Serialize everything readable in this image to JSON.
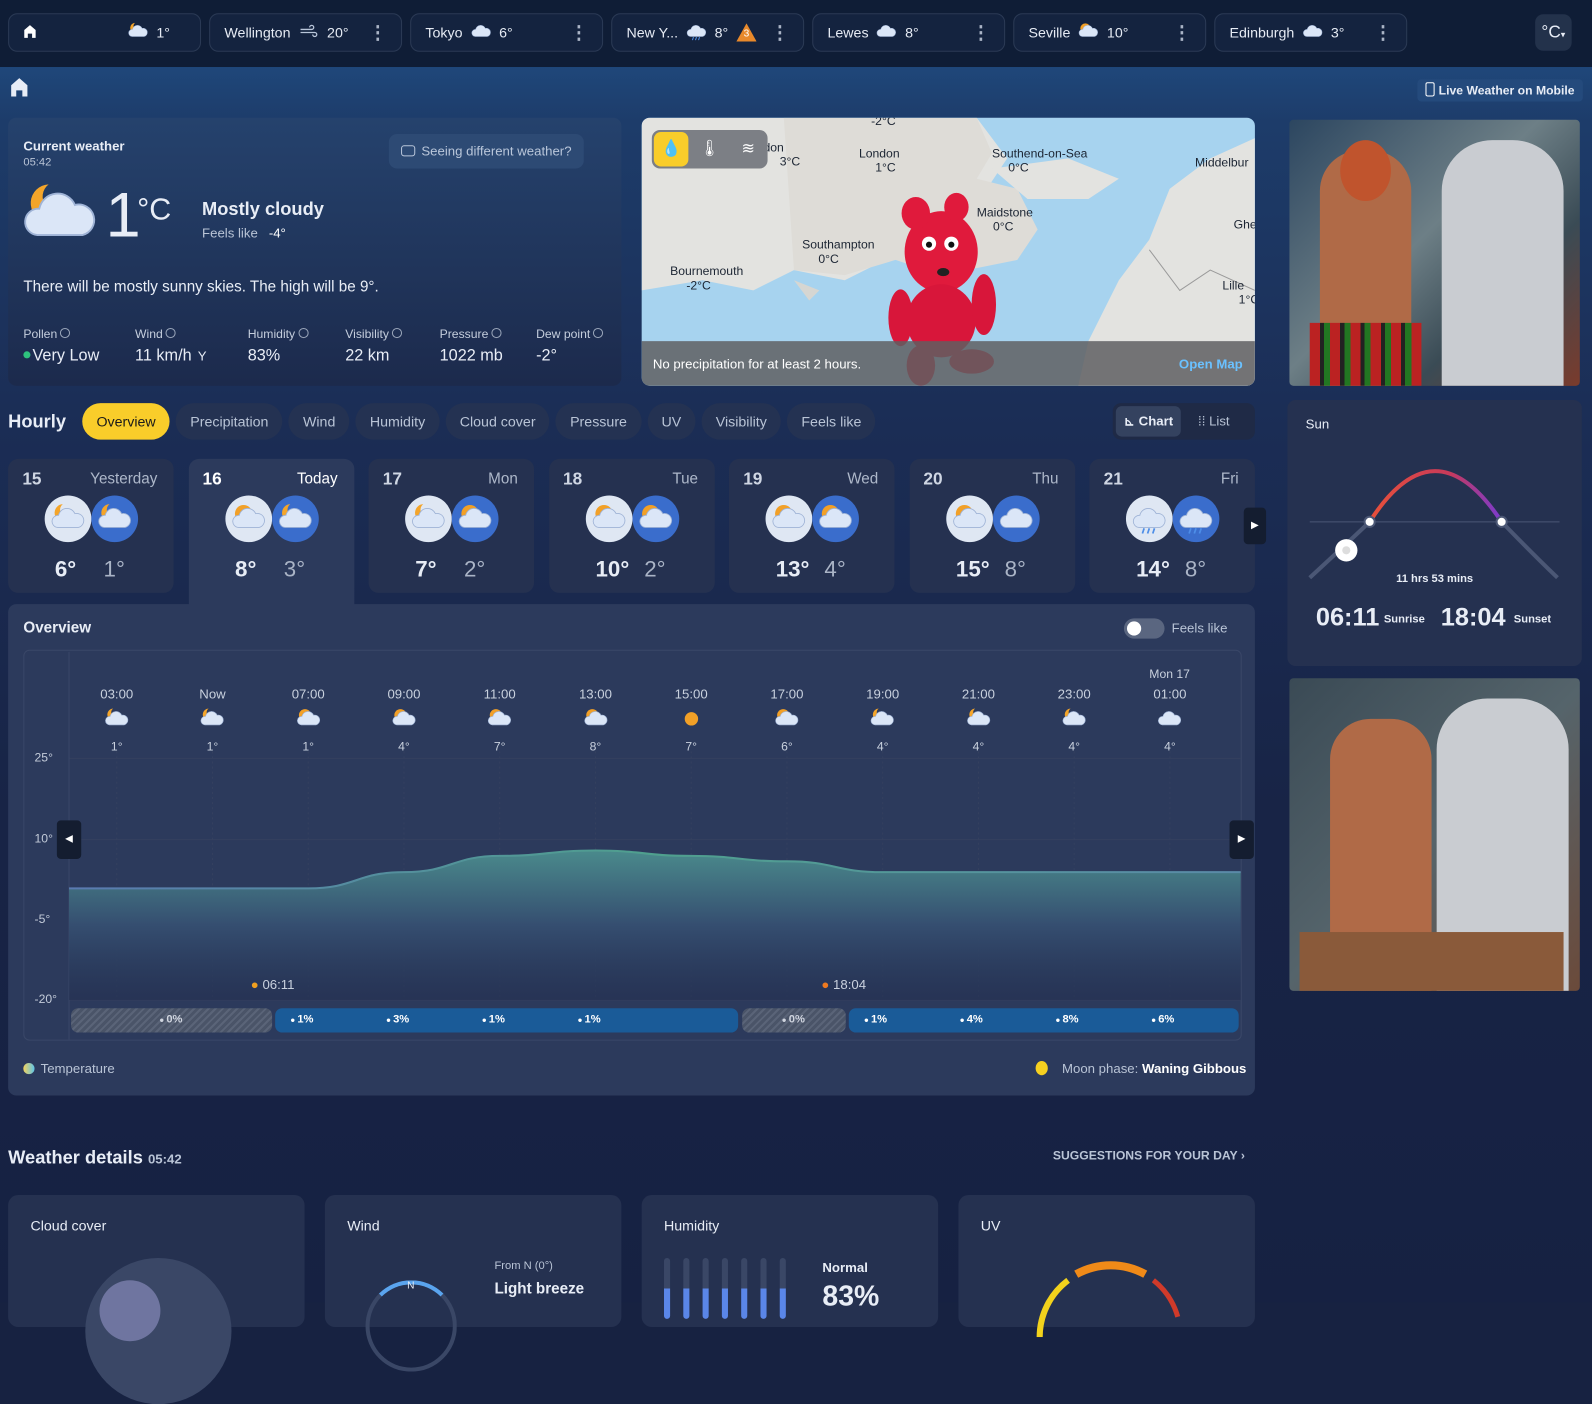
{
  "locations": [
    {
      "name": "",
      "temp": "1°",
      "icon": "moon-cloud",
      "home": true
    },
    {
      "name": "Wellington",
      "temp": "20°",
      "icon": "windy"
    },
    {
      "name": "Tokyo",
      "temp": "6°",
      "icon": "cloud"
    },
    {
      "name": "New Y...",
      "temp": "8°",
      "icon": "rain-cloud",
      "alert": "3"
    },
    {
      "name": "Lewes",
      "temp": "8°",
      "icon": "cloud"
    },
    {
      "name": "Seville",
      "temp": "10°",
      "icon": "sun-cloud"
    },
    {
      "name": "Edinburgh",
      "temp": "3°",
      "icon": "cloud"
    }
  ],
  "unit": "°C",
  "mobile_label": "Live Weather on Mobile",
  "current": {
    "title": "Current weather",
    "time": "05:42",
    "temp": "1",
    "unit": "°C",
    "condition": "Mostly cloudy",
    "feels_label": "Feels like",
    "feels_value": "-4°",
    "feedback": "Seeing different weather?",
    "summary": "There will be mostly sunny skies. The high will be 9°.",
    "stats": [
      {
        "label": "Pollen",
        "value": "Very Low"
      },
      {
        "label": "Wind",
        "value": "11 km/h"
      },
      {
        "label": "Humidity",
        "value": "83%"
      },
      {
        "label": "Visibility",
        "value": "22 km"
      },
      {
        "label": "Pressure",
        "value": "1022 mb"
      },
      {
        "label": "Dew point",
        "value": "-2°"
      }
    ]
  },
  "map": {
    "labels": [
      {
        "name": "London",
        "temp": "1°C"
      },
      {
        "name": "Southend-on-Sea",
        "temp": "0°C"
      },
      {
        "name": "Maidstone",
        "temp": "0°C"
      },
      {
        "name": "Southampton",
        "temp": "0°C"
      },
      {
        "name": "Bournemouth",
        "temp": "-2°C"
      },
      {
        "name": "Lille",
        "temp": "1°C"
      },
      {
        "name": "Middelbur",
        "temp": ""
      },
      {
        "name": "don",
        "temp": "3°C"
      },
      {
        "name": "",
        "temp": "-2°C"
      },
      {
        "name": "Ghe",
        "temp": ""
      }
    ],
    "status": "No precipitation for at least 2 hours.",
    "open": "Open Map"
  },
  "hourly": {
    "title": "Hourly",
    "tabs": [
      "Overview",
      "Precipitation",
      "Wind",
      "Humidity",
      "Cloud cover",
      "Pressure",
      "UV",
      "Visibility",
      "Feels like"
    ],
    "view_chart": "Chart",
    "view_list": "List"
  },
  "days": [
    {
      "num": "15",
      "name": "Yesterday",
      "hi": "6°",
      "lo": "1°"
    },
    {
      "num": "16",
      "name": "Today",
      "hi": "8°",
      "lo": "3°"
    },
    {
      "num": "17",
      "name": "Mon",
      "hi": "7°",
      "lo": "2°"
    },
    {
      "num": "18",
      "name": "Tue",
      "hi": "10°",
      "lo": "2°"
    },
    {
      "num": "19",
      "name": "Wed",
      "hi": "13°",
      "lo": "4°"
    },
    {
      "num": "20",
      "name": "Thu",
      "hi": "15°",
      "lo": "8°"
    },
    {
      "num": "21",
      "name": "Fri",
      "hi": "14°",
      "lo": "8°"
    }
  ],
  "overview": {
    "title": "Overview",
    "feels_toggle": "Feels like",
    "next_day_label": "Mon 17",
    "sunrise": "06:11",
    "sunset": "18:04",
    "legend": "Temperature",
    "moon_label": "Moon phase:",
    "moon_value": "Waning Gibbous"
  },
  "chart_data": {
    "type": "area",
    "ylabel_ticks": [
      "25°",
      "10°",
      "-5°",
      "-20°"
    ],
    "ylim": [
      -20,
      25
    ],
    "hours": [
      "03:00",
      "Now",
      "07:00",
      "09:00",
      "11:00",
      "13:00",
      "15:00",
      "17:00",
      "19:00",
      "21:00",
      "23:00",
      "01:00"
    ],
    "icons": [
      "moon-cloud",
      "moon-cloud",
      "sun-cloud",
      "sun-cloud",
      "sun-cloud",
      "sun-cloud",
      "sun",
      "sun-cloud",
      "moon-cloud",
      "moon-cloud",
      "moon-cloud",
      "cloud"
    ],
    "temps": [
      1,
      1,
      1,
      4,
      7,
      8,
      7,
      6,
      4,
      4,
      4,
      4
    ],
    "temps_display": [
      "1°",
      "1°",
      "1°",
      "4°",
      "7°",
      "8°",
      "7°",
      "6°",
      "4°",
      "4°",
      "4°",
      "4°"
    ],
    "precip": [
      {
        "type": "dry",
        "values": [
          "0%"
        ]
      },
      {
        "type": "wet",
        "values": [
          "1%",
          "3%",
          "1%",
          "1%"
        ]
      },
      {
        "type": "dry",
        "values": [
          "0%"
        ]
      },
      {
        "type": "wet",
        "values": [
          "1%",
          "4%",
          "8%",
          "6%"
        ]
      }
    ]
  },
  "sun": {
    "title": "Sun",
    "duration": "11 hrs 53 mins",
    "sunrise": "06:11",
    "sunrise_label": "Sunrise",
    "sunset": "18:04",
    "sunset_label": "Sunset"
  },
  "details": {
    "title": "Weather details",
    "time": "05:42",
    "suggestions": "SUGGESTIONS FOR YOUR DAY",
    "cards": [
      {
        "title": "Cloud cover"
      },
      {
        "title": "Wind",
        "from": "From N (0°)",
        "desc": "Light breeze",
        "compass": "N"
      },
      {
        "title": "Humidity",
        "level": "Normal",
        "value": "83%"
      },
      {
        "title": "UV"
      }
    ]
  },
  "colors": {
    "accent": "#f9cd2a",
    "precip": "#1a5b98",
    "topbar": "#0f1d36"
  }
}
